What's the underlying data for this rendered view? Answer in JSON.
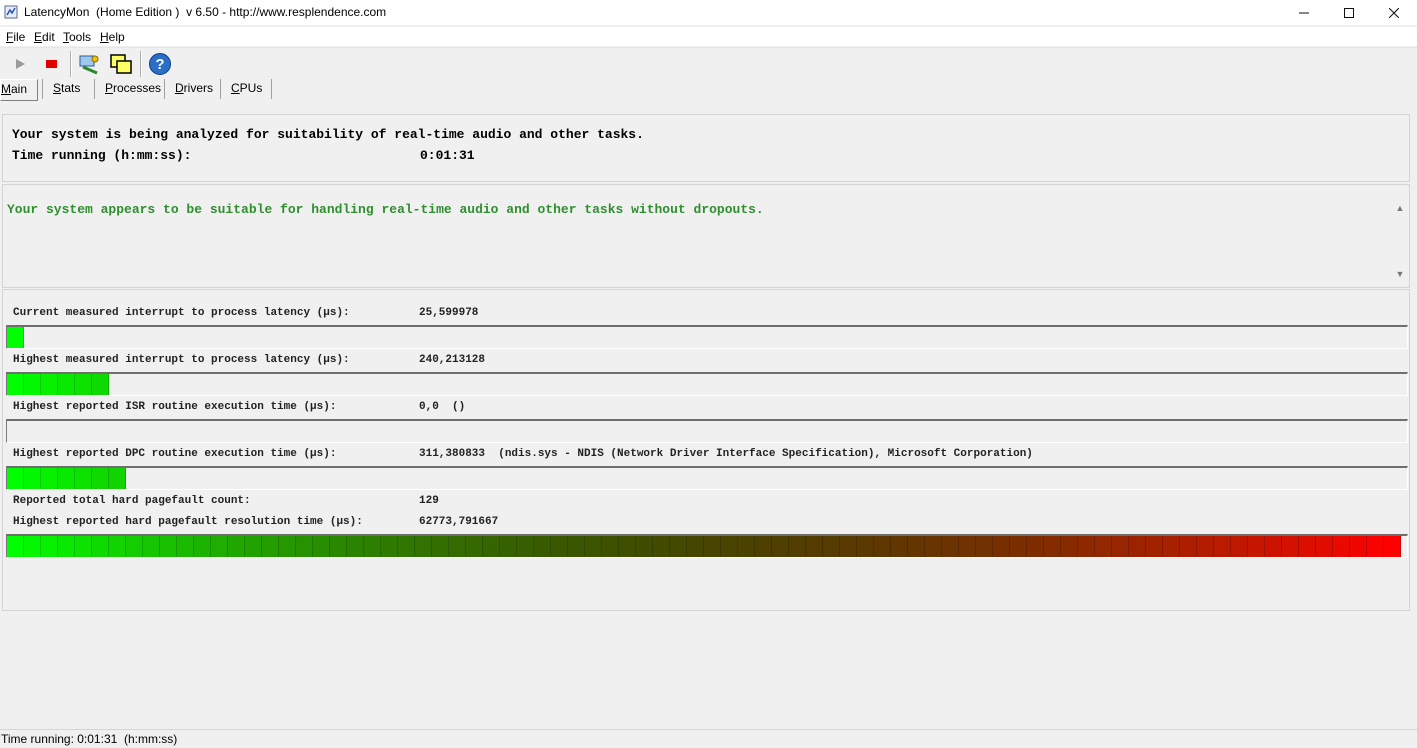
{
  "window": {
    "title": "LatencyMon  (Home Edition )  v 6.50 - http://www.resplendence.com"
  },
  "menu": {
    "items": [
      {
        "accel": "F",
        "rest": "ile"
      },
      {
        "accel": "E",
        "rest": "dit"
      },
      {
        "accel": "T",
        "rest": "ools"
      },
      {
        "accel": "H",
        "rest": "elp"
      }
    ]
  },
  "toolbar": {
    "icons": [
      "play-icon",
      "stop-icon",
      "analyze-icon",
      "windows-icon",
      "help-icon"
    ]
  },
  "tabs": [
    {
      "accel": "M",
      "rest": "ain",
      "active": true
    },
    {
      "accel": "S",
      "rest": "tats",
      "active": false
    },
    {
      "accel": "P",
      "rest": "rocesses",
      "active": false
    },
    {
      "accel": "D",
      "rest": "rivers",
      "active": false
    },
    {
      "accel": "C",
      "rest": "PUs",
      "active": false
    }
  ],
  "summary": {
    "line1": "Your system is being analyzed for suitability of real-time audio and other tasks.",
    "time_label": "Time running (h:mm:ss):",
    "time_value": "0:01:31"
  },
  "verdict": {
    "text": "Your system appears to be suitable for handling real-time audio and other tasks without dropouts.",
    "color": "#2f8f2f"
  },
  "metrics": [
    {
      "label": "Current measured interrupt to process latency (µs):",
      "value": "25,599978",
      "level": 0.011,
      "has_bar": true
    },
    {
      "label": "Highest measured interrupt to process latency (µs):",
      "value": "240,213128",
      "level": 0.071,
      "has_bar": true
    },
    {
      "label": "Highest reported ISR routine execution time (µs):",
      "value": "0,0  ()",
      "level": 0.0,
      "has_bar": true
    },
    {
      "label": "Highest reported DPC routine execution time (µs):",
      "value": "311,380833  (ndis.sys - NDIS (Network Driver Interface Specification), Microsoft Corporation)",
      "level": 0.083,
      "has_bar": true
    },
    {
      "label": "Reported total hard pagefault count:",
      "value": "129",
      "level": null,
      "has_bar": false
    },
    {
      "label": "Highest reported hard pagefault resolution time (µs):",
      "value": "62773,791667",
      "level": 1.0,
      "has_bar": true
    }
  ],
  "colors": {
    "bar_low": "#00ff00",
    "bar_high": "#ff0000"
  },
  "status": {
    "text": "Time running: 0:01:31  (h:mm:ss)"
  }
}
